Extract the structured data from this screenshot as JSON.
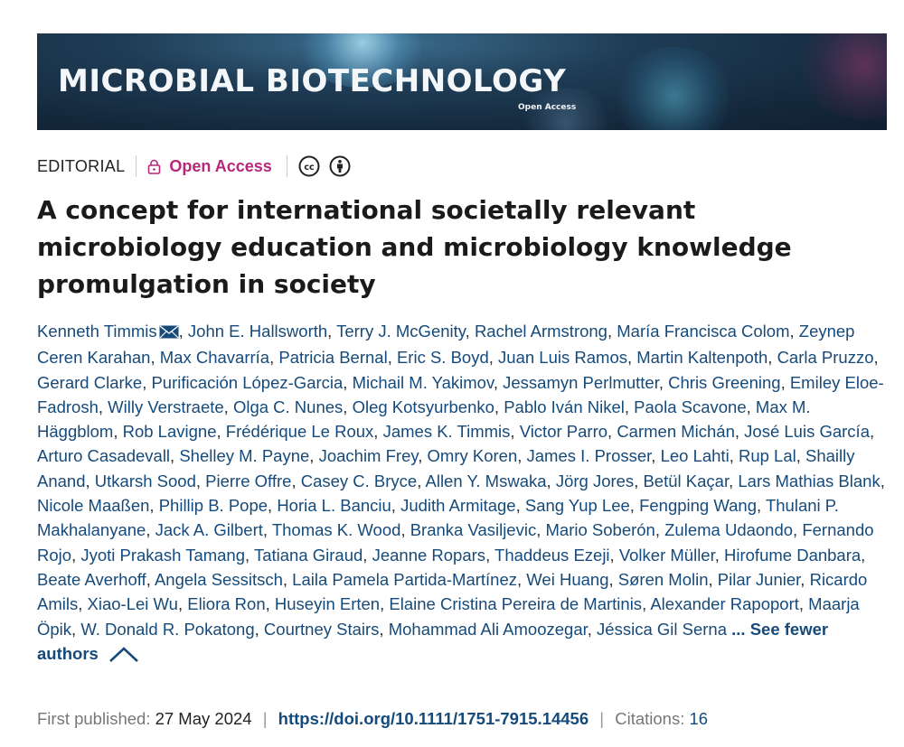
{
  "banner": {
    "journal_name": "MICROBIAL BIOTECHNOLOGY",
    "journal_subtitle": "Open Access"
  },
  "meta": {
    "article_type": "EDITORIAL",
    "access_label": "Open Access",
    "access_color": "#b8277a",
    "icons": [
      "lock-icon",
      "creative-commons-icon",
      "attribution-icon"
    ]
  },
  "article": {
    "title": "A concept for international societally relevant microbiology education and microbiology knowledge promulgation in society"
  },
  "authors": [
    "Kenneth Timmis",
    "John E. Hallsworth",
    "Terry J. McGenity",
    "Rachel Armstrong",
    "María Francisca Colom",
    "Zeynep Ceren Karahan",
    "Max Chavarría",
    "Patricia Bernal",
    "Eric S. Boyd",
    "Juan Luis Ramos",
    "Martin Kaltenpoth",
    "Carla Pruzzo",
    "Gerard Clarke",
    "Purificación López-Garcia",
    "Michail M. Yakimov",
    "Jessamyn Perlmutter",
    "Chris Greening",
    "Emiley Eloe-Fadrosh",
    "Willy Verstraete",
    "Olga C. Nunes",
    "Oleg Kotsyurbenko",
    "Pablo Iván Nikel",
    "Paola Scavone",
    "Max M. Häggblom",
    "Rob Lavigne",
    "Frédérique Le Roux",
    "James K. Timmis",
    "Victor Parro",
    "Carmen Michán",
    "José Luis García",
    "Arturo Casadevall",
    "Shelley M. Payne",
    "Joachim Frey",
    "Omry Koren",
    "James I. Prosser",
    "Leo Lahti",
    "Rup Lal",
    "Shailly Anand",
    "Utkarsh Sood",
    "Pierre Offre",
    "Casey C. Bryce",
    "Allen Y. Mswaka",
    "Jörg Jores",
    "Betül Kaçar",
    "Lars Mathias Blank",
    "Nicole Maaßen",
    "Phillip B. Pope",
    "Horia L. Banciu",
    "Judith Armitage",
    "Sang Yup Lee",
    "Fengping Wang",
    "Thulani P. Makhalanyane",
    "Jack A. Gilbert",
    "Thomas K. Wood",
    "Branka Vasiljevic",
    "Mario Soberón",
    "Zulema Udaondo",
    "Fernando Rojo",
    "Jyoti Prakash Tamang",
    "Tatiana Giraud",
    "Jeanne Ropars",
    "Thaddeus Ezeji",
    "Volker Müller",
    "Hirofume Danbara",
    "Beate Averhoff",
    "Angela Sessitsch",
    "Laila Pamela Partida-Martínez",
    "Wei Huang",
    "Søren Molin",
    "Pilar Junier",
    "Ricardo Amils",
    "Xiao-Lei Wu",
    "Eliora Ron",
    "Huseyin Erten",
    "Elaine Cristina Pereira de Martinis",
    "Alexander Rapoport",
    "Maarja Öpik",
    "W. Donald R. Pokatong",
    "Courtney Stairs",
    "Mohammad Ali Amoozegar",
    "Jéssica Gil Serna"
  ],
  "authors_ui": {
    "see_fewer_label": "... See fewer authors",
    "corresponding_icon": "envelope-icon",
    "toggle_icon": "chevron-up-icon"
  },
  "publication": {
    "first_published_label": "First published:",
    "first_published_date": "27 May 2024",
    "doi": "https://doi.org/10.1111/1751-7915.14456",
    "citations_label": "Citations:",
    "citations_count": "16"
  }
}
